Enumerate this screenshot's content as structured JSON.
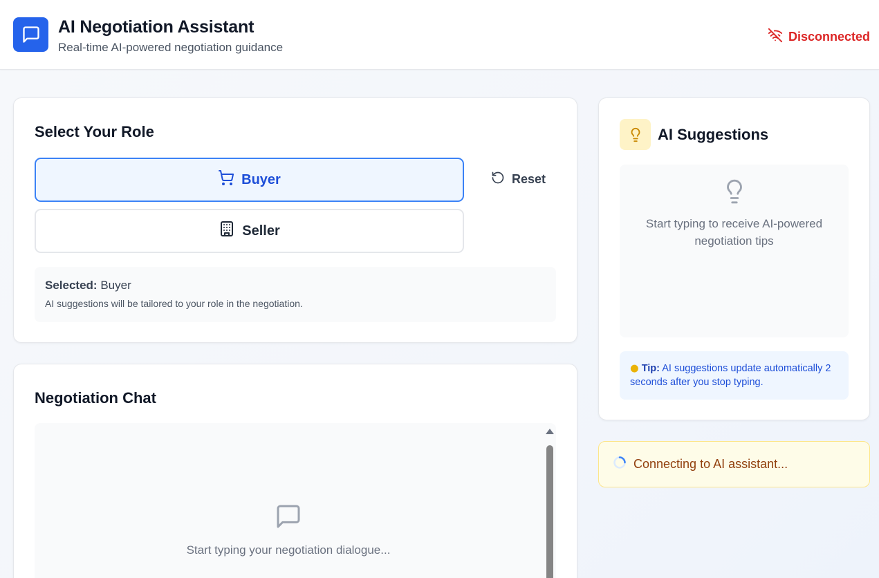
{
  "header": {
    "title": "AI Negotiation Assistant",
    "subtitle": "Real-time AI-powered negotiation guidance",
    "status": "Disconnected",
    "logo_icon": "chat-bubble-icon",
    "status_icon": "wifi-off-icon"
  },
  "role": {
    "title": "Select Your Role",
    "buyer_label": "Buyer",
    "seller_label": "Seller",
    "reset_label": "Reset",
    "selected_prefix": "Selected:",
    "selected_value": "Buyer",
    "help": "AI suggestions will be tailored to your role in the negotiation."
  },
  "chat": {
    "title": "Negotiation Chat",
    "empty_text": "Start typing your negotiation dialogue..."
  },
  "suggestions": {
    "title": "AI Suggestions",
    "empty_text": "Start typing to receive AI-powered negotiation tips",
    "tip_label": "Tip:",
    "tip_text": "AI suggestions update automatically 2 seconds after you stop typing."
  },
  "connection": {
    "text": "Connecting to AI assistant..."
  },
  "colors": {
    "primary": "#2563eb",
    "danger": "#dc2626",
    "warning_bg": "#fefce8",
    "tip_bg": "#eff6ff"
  }
}
